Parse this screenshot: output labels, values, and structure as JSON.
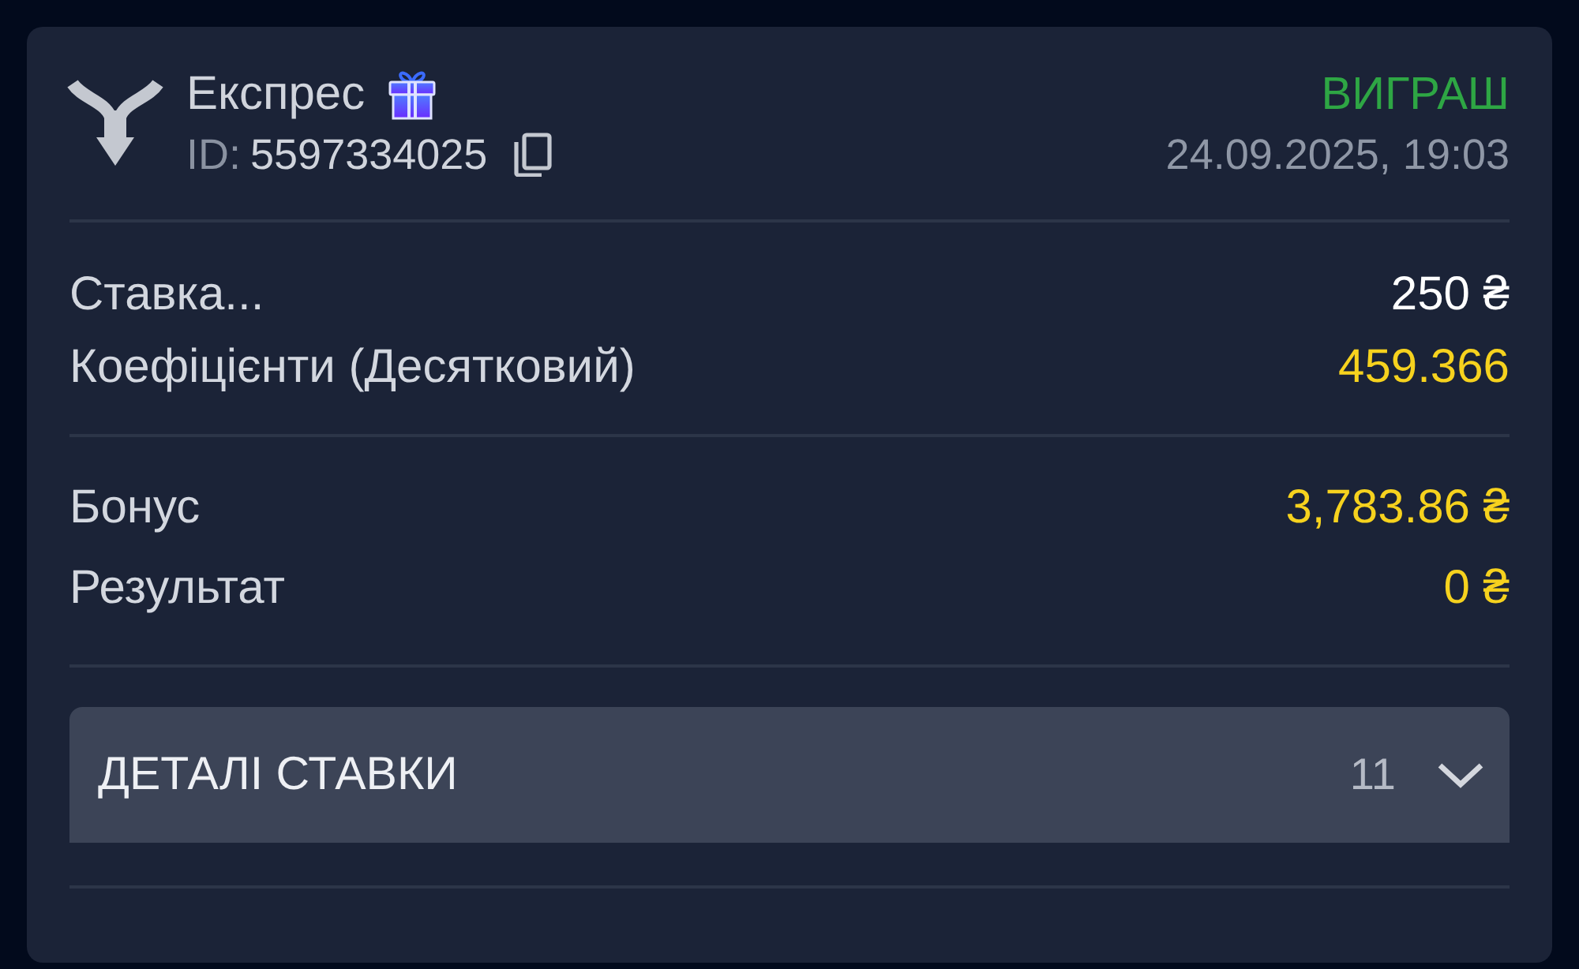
{
  "bet": {
    "type": "Експрес",
    "bonus_badge": true,
    "id_label": "ID:",
    "id_value": "5597334025",
    "status": "ВИГРАШ",
    "datetime": "24.09.2025, 19:03"
  },
  "summary": [
    {
      "label": "Ставка...",
      "value": "250 ₴",
      "kind": "plain"
    },
    {
      "label": "Коефіцієнти (Десятковий)",
      "value": "459.366",
      "kind": "highlight"
    }
  ],
  "results": [
    {
      "label": "Бонус",
      "value": "3,783.86 ₴",
      "kind": "highlight"
    },
    {
      "label": "Результат",
      "value": "0 ₴",
      "kind": "highlight"
    }
  ],
  "details": {
    "label": "ДЕТАЛІ СТАВКИ",
    "count": "11",
    "expanded": false
  }
}
